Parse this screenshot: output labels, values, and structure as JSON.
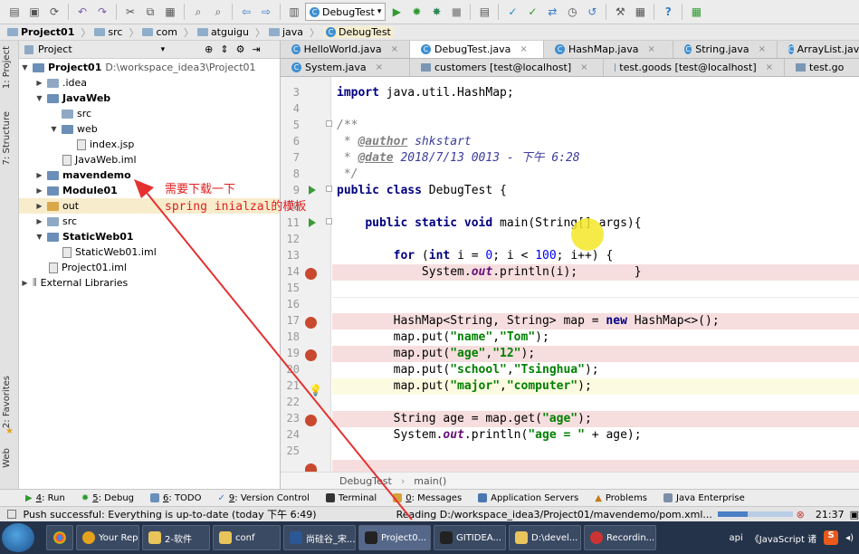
{
  "toolbar": {
    "run_config": "DebugTest",
    "icons": [
      "open-icon",
      "save-icon",
      "sync-icon",
      "undo-icon",
      "redo-icon",
      "cut-icon",
      "copy-icon",
      "paste-icon",
      "find-icon",
      "replace-icon",
      "back-icon",
      "forward-icon",
      "build-icon",
      "run-icon",
      "debug-icon",
      "coverage-icon",
      "stop-icon",
      "structure-icon",
      "vcs-update-icon",
      "vcs-commit-icon",
      "vcs-compare-icon",
      "vcs-history-icon",
      "vcs-revert-icon",
      "settings-icon",
      "project-structure-icon",
      "help-icon",
      "plugin-icon"
    ]
  },
  "navbar": {
    "crumbs": [
      "Project01",
      "src",
      "com",
      "atguigu",
      "java",
      "DebugTest"
    ]
  },
  "left_strip": {
    "tab1": "1: Project",
    "tab2": "7: Structure",
    "tab3": "2: Favorites",
    "tab4": "Web"
  },
  "project_panel": {
    "header": "Project",
    "tree": [
      {
        "label": "Project01",
        "path": "D:\\workspace_idea3\\Project01",
        "bold": true
      },
      {
        "label": ".idea"
      },
      {
        "label": "JavaWeb",
        "bold": true
      },
      {
        "label": "src"
      },
      {
        "label": "web"
      },
      {
        "label": "index.jsp"
      },
      {
        "label": "JavaWeb.iml"
      },
      {
        "label": "mavendemo",
        "bold": true
      },
      {
        "label": "Module01",
        "bold": true
      },
      {
        "label": "out"
      },
      {
        "label": "src"
      },
      {
        "label": "StaticWeb01",
        "bold": true
      },
      {
        "label": "StaticWeb01.iml"
      },
      {
        "label": "Project01.iml"
      },
      {
        "label": "External Libraries"
      }
    ]
  },
  "editor": {
    "tabs_row1": [
      "HelloWorld.java",
      "DebugTest.java",
      "HashMap.java",
      "String.java",
      "ArrayList.java"
    ],
    "tabs_row2": [
      "System.java",
      "customers [test@localhost]",
      "test.goods [test@localhost]",
      "test.go"
    ],
    "line_numbers": [
      "3",
      "4",
      "5",
      "6",
      "7",
      "8",
      "9",
      "10",
      "11",
      "12",
      "13",
      "14",
      "15",
      "16",
      "17",
      "18",
      "19",
      "20",
      "21",
      "22",
      "23",
      "24",
      "25"
    ],
    "code": {
      "l3_kw": "import",
      "l3_rest": " java.util.HashMap;",
      "l5": "/**",
      "l6_pre": " * ",
      "l6_tag": "@author",
      "l6_val": " shkstart",
      "l7_pre": " * ",
      "l7_tag": "@date",
      "l7_val": " 2018/7/13 0013 - 下午 6:28",
      "l8": " */",
      "l9_kw": "public class",
      "l9_rest": " DebugTest {",
      "l11_indent": "    ",
      "l11_kw": "public static void",
      "l11_rest": " main(String[] args){",
      "l13_indent": "        ",
      "l13_kw1": "for",
      "l13_a": " (",
      "l13_kw2": "int",
      "l13_b": " i = ",
      "l13_n1": "0",
      "l13_c": "; i < ",
      "l13_n2": "100",
      "l13_d": "; i++) {",
      "l14_a": "            System.",
      "l14_fld": "out",
      "l14_b": ".println(i);        }",
      "l17_a": "        HashMap<String, String> map = ",
      "l17_kw": "new",
      "l17_b": " HashMap<>();",
      "l18_a": "        map.put(",
      "l18_s1": "\"name\"",
      "l18_c": ",",
      "l18_s2": "\"Tom\"",
      "l18_d": ");",
      "l19_s1": "\"age\"",
      "l19_s2": "\"12\"",
      "l20_s1": "\"school\"",
      "l20_s2": "\"Tsinghua\"",
      "l21_s1": "\"major\"",
      "l21_s2": "\"computer\"",
      "l23_a": "        String age = map.get(",
      "l23_s": "\"age\"",
      "l23_b": ");",
      "l24_a": "        System.",
      "l24_fld": "out",
      "l24_b": ".println(",
      "l24_s": "\"age = \"",
      "l24_c": " + age);"
    },
    "breadcrumb_class": "DebugTest",
    "breadcrumb_method": "main()"
  },
  "annotation": {
    "line1": "需要下载一下",
    "line2": "spring inialzal的模板"
  },
  "tool_windows": [
    {
      "key": "4",
      "label": ": Run"
    },
    {
      "key": "5",
      "label": ": Debug"
    },
    {
      "key": "6",
      "label": ": TODO"
    },
    {
      "key": "9",
      "label": ": Version Control"
    },
    {
      "key": "",
      "label": "Terminal"
    },
    {
      "key": "0",
      "label": ": Messages"
    },
    {
      "key": "",
      "label": "Application Servers"
    },
    {
      "key": "",
      "label": "Problems"
    },
    {
      "key": "",
      "label": "Java Enterprise"
    }
  ],
  "status": {
    "message": "Push successful: Everything is up-to-date (today 下午 6:49)",
    "progress": "Reading D:/workspace_idea3/Project01/mavendemo/pom.xml...",
    "time": "21:37"
  },
  "taskbar": {
    "items": [
      "Your Rep...",
      "2-软件",
      "conf",
      "尚硅谷_宋...",
      "Project0...",
      "GITIDEA...",
      "D:\\devel...",
      "Recordin...",
      "api",
      "《JavaScript 诸"
    ]
  },
  "colors": {
    "breakpoint": "#c9492e",
    "annotation": "#e02020",
    "keyword": "#000080",
    "string": "#008000"
  }
}
